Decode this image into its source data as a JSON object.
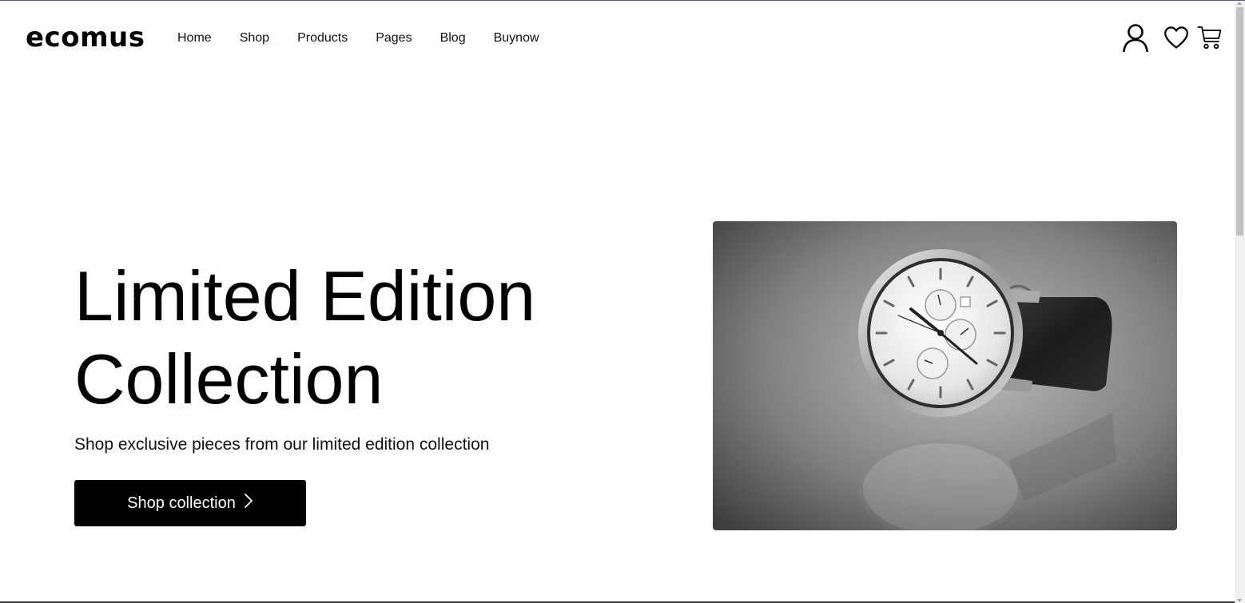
{
  "header": {
    "logo": "ecomus",
    "nav": [
      "Home",
      "Shop",
      "Products",
      "Pages",
      "Blog",
      "Buynow"
    ],
    "icons": [
      "user-icon",
      "heart-icon",
      "cart-icon"
    ]
  },
  "hero": {
    "title_line1": "Limited Edition",
    "title_line2": "Collection",
    "subtitle": "Shop exclusive pieces from our limited edition collection",
    "cta_label": "Shop collection",
    "cta_icon": "chevron-right-icon",
    "image_subject": "watch-image"
  },
  "colors": {
    "text": "#000000",
    "button_bg": "#000000",
    "button_text": "#ffffff",
    "background": "#ffffff"
  }
}
